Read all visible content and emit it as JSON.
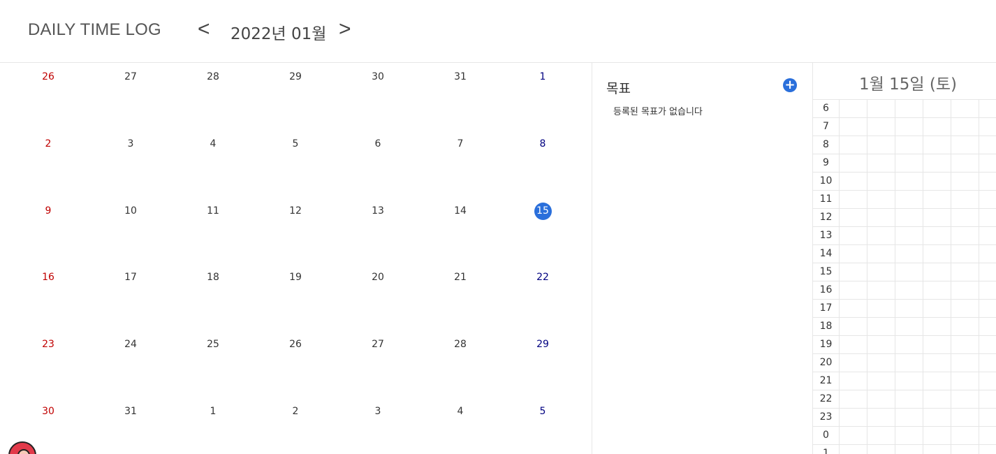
{
  "header": {
    "app_title": "DAILY TIME LOG",
    "prev_label": "<",
    "next_label": ">",
    "month": "2022년 01월"
  },
  "calendar": {
    "weeks": [
      [
        "26",
        "27",
        "28",
        "29",
        "30",
        "31",
        "1"
      ],
      [
        "2",
        "3",
        "4",
        "5",
        "6",
        "7",
        "8"
      ],
      [
        "9",
        "10",
        "11",
        "12",
        "13",
        "14",
        "15"
      ],
      [
        "16",
        "17",
        "18",
        "19",
        "20",
        "21",
        "22"
      ],
      [
        "23",
        "24",
        "25",
        "26",
        "27",
        "28",
        "29"
      ],
      [
        "30",
        "31",
        "1",
        "2",
        "3",
        "4",
        "5"
      ]
    ],
    "today": "15",
    "sunday_color": "#c00000",
    "saturday_color": "#000080",
    "today_color": "#2a6fdb"
  },
  "goals": {
    "title": "목표",
    "add_icon": "+",
    "empty_text": "등록된 목표가 없습니다"
  },
  "timeline": {
    "date_title": "1월 15일 (토)",
    "hours": [
      "6",
      "7",
      "8",
      "9",
      "10",
      "11",
      "12",
      "13",
      "14",
      "15",
      "16",
      "17",
      "18",
      "19",
      "20",
      "21",
      "22",
      "23",
      "0",
      "1"
    ]
  },
  "icons": {
    "add_goal": "plus-circle-icon",
    "avatar": "user-avatar-icon"
  }
}
